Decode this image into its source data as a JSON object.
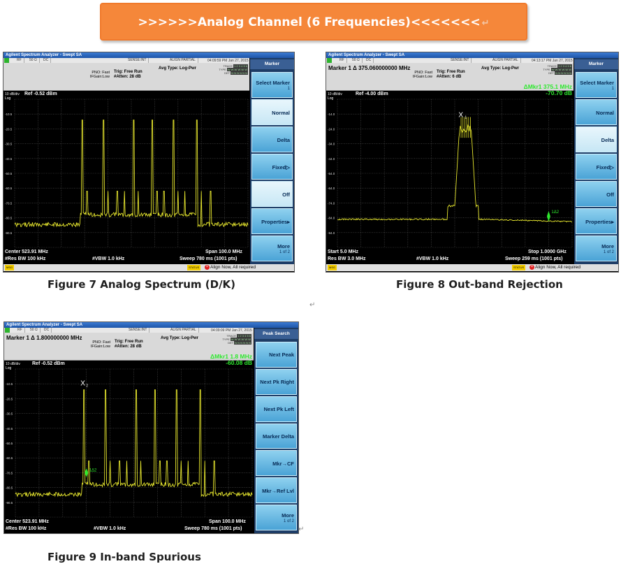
{
  "banner": {
    "title": ">>>>>>Analog Channel (6 Frequencies)<<<<<<<",
    "return_mark": "↵"
  },
  "common": {
    "app_title": "Agilent Spectrum Analyzer - Swept SA",
    "tab_rf": "RF",
    "tab_ohm": "50 Ω",
    "tab_dc": "DC",
    "sense": "SENSE:INT",
    "align": "ALIGN PARTIAL",
    "trace_label": "TRACE",
    "type_label": "TYPE",
    "det_label": "DET",
    "trace_value": "1 2 3 4 5 6",
    "type_value": "W W W W W W",
    "det_value": "N N N N N N",
    "pno": "PNO: Fast",
    "ifgain": "IFGain:Low",
    "trig": "Trig: Free Run",
    "avg": "Avg Type: Log-Pwr",
    "scale": "10 dB/div",
    "log": "Log",
    "vbw": "#VBW 1.0 kHz",
    "msg": "MSG",
    "status_label": "STATUS",
    "status_text": "Align Now, All required"
  },
  "fig7": {
    "date": "04:09:59 PM Jan 27, 2015",
    "atten": "#Atten: 28 dB",
    "ref": "Ref -0.52 dBm",
    "y_ticks": [
      "-10.5",
      "-20.5",
      "-30.5",
      "-40.5",
      "-50.5",
      "-60.5",
      "-70.5",
      "-80.5",
      "-90.5"
    ],
    "center": "Center 523.91 MHz",
    "rbw": "#Res BW 100 kHz",
    "span": "Span 100.0 MHz",
    "sweep": "Sweep  780 ms (1001 pts)",
    "panel_title": "Marker",
    "softkeys": [
      {
        "label": "Select Marker",
        "sub": "1"
      },
      {
        "label": "Normal",
        "sub": ""
      },
      {
        "label": "Delta",
        "sub": ""
      },
      {
        "label": "Fixed▷",
        "sub": ""
      },
      {
        "label": "Off",
        "sub": ""
      },
      {
        "label": "Properties▸",
        "sub": ""
      },
      {
        "label": "More",
        "sub": "1 of 2"
      }
    ],
    "caption": "Figure 7 Analog Spectrum (D/K)"
  },
  "fig8": {
    "date": "04:13:17 PM Jan 27, 2015",
    "marker": "Marker 1 Δ  375.060000000 MHz",
    "atten": "#Atten: 6 dB",
    "ref": "Ref -4.00 dBm",
    "delta_line1": "ΔMkr1 375.1 MHz",
    "delta_line2": "-70.70 dB",
    "marker_x": "X",
    "marker_1": "1",
    "marker_delta": "1Δ2",
    "y_ticks": [
      "-14.0",
      "-24.0",
      "-34.0",
      "-44.0",
      "-54.0",
      "-64.0",
      "-74.0",
      "-84.0",
      "-94.0"
    ],
    "start": "Start 5.0 MHz",
    "rbw": "Res BW 3.0 MHz",
    "stop": "Stop 1.0000 GHz",
    "sweep": "Sweep  259 ms (1001 pts)",
    "panel_title": "Marker",
    "softkeys": [
      {
        "label": "Select Marker",
        "sub": "1"
      },
      {
        "label": "Normal",
        "sub": ""
      },
      {
        "label": "Delta",
        "sub": ""
      },
      {
        "label": "Fixed▷",
        "sub": ""
      },
      {
        "label": "Off",
        "sub": ""
      },
      {
        "label": "Properties▸",
        "sub": ""
      },
      {
        "label": "More",
        "sub": "1 of 2"
      }
    ],
    "caption": "Figure 8 Out-band Rejection"
  },
  "fig9": {
    "date": "04:09:09 PM Jan 27, 2015",
    "marker": "Marker 1 Δ  1.800000000 MHz",
    "atten": "#Atten: 28 dB",
    "ref": "Ref -0.52 dBm",
    "delta_line1": "ΔMkr1 1.8 MHz",
    "delta_line2": "-60.08 dB",
    "marker_x": "X",
    "marker_2": "2",
    "marker_delta": "1Δ2",
    "y_ticks": [
      "-10.5",
      "-20.5",
      "-30.5",
      "-40.5",
      "-50.5",
      "-60.5",
      "-70.5",
      "-80.5",
      "-90.5"
    ],
    "center": "Center 523.91 MHz",
    "rbw": "#Res BW 100 kHz",
    "span": "Span 100.0 MHz",
    "sweep": "Sweep  780 ms (1001 pts)",
    "panel_title": "Peak Search",
    "softkeys": [
      {
        "label": "Next Peak",
        "sub": ""
      },
      {
        "label": "Next Pk Right",
        "sub": ""
      },
      {
        "label": "Next Pk Left",
        "sub": ""
      },
      {
        "label": "Marker Delta",
        "sub": ""
      },
      {
        "label": "Mkr→CF",
        "sub": ""
      },
      {
        "label": "Mkr→Ref Lvl",
        "sub": ""
      },
      {
        "label": "More",
        "sub": "1 of 2"
      }
    ],
    "caption": "Figure 9 In-band Spurious"
  },
  "colors": {
    "trace": "#e6e62e",
    "marker_green": "#2ee82e",
    "banner": "#f5873a"
  }
}
